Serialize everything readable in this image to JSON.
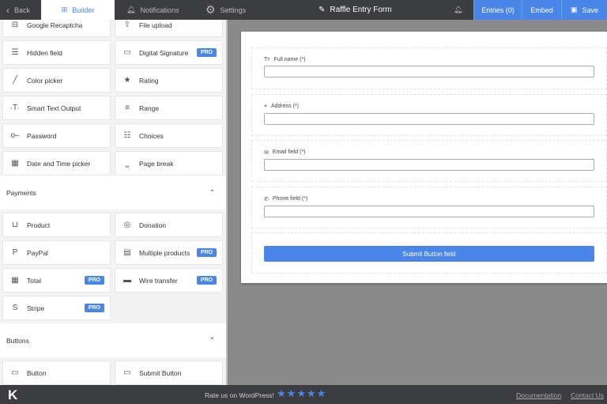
{
  "header": {
    "back": "Back",
    "builder": "Builder",
    "notifications": "Notifications",
    "settings": "Settings",
    "form_title": "Raffle Entry Form",
    "entries": "Entries (0)",
    "embed": "Embed",
    "save": "Save",
    "accent": "#4a86e8"
  },
  "sidebar": {
    "fields": [
      {
        "label": "Google Recaptcha",
        "icon": "recaptcha-icon",
        "glyph": "⊟"
      },
      {
        "label": "File upload",
        "icon": "upload-icon",
        "glyph": "⇧"
      },
      {
        "label": "Hidden field",
        "icon": "hidden-field-icon",
        "glyph": "☰"
      },
      {
        "label": "Digital Signature",
        "icon": "signature-icon",
        "glyph": "▭",
        "pro": "PRO"
      },
      {
        "label": "Color picker",
        "icon": "pencil-icon",
        "glyph": "╱"
      },
      {
        "label": "Rating",
        "icon": "star-icon",
        "glyph": "★"
      },
      {
        "label": "Smart Text Output",
        "icon": "text-icon",
        "glyph": "·T·"
      },
      {
        "label": "Range",
        "icon": "range-icon",
        "glyph": "≡"
      },
      {
        "label": "Password",
        "icon": "key-icon",
        "glyph": "o‒"
      },
      {
        "label": "Choices",
        "icon": "choices-icon",
        "glyph": "☷"
      },
      {
        "label": "Date and Time picker",
        "icon": "calendar-icon",
        "glyph": "▦"
      },
      {
        "label": "Page break",
        "icon": "page-break-icon",
        "glyph": "⎵"
      }
    ],
    "payments_title": "Payments",
    "payments": [
      {
        "label": "Product",
        "icon": "basket-icon",
        "glyph": "⊔"
      },
      {
        "label": "Donation",
        "icon": "coins-icon",
        "glyph": "◎"
      },
      {
        "label": "PayPal",
        "icon": "paypal-icon",
        "glyph": "P"
      },
      {
        "label": "Multiple products",
        "icon": "products-icon",
        "glyph": "▤",
        "pro": "PRO"
      },
      {
        "label": "Total",
        "icon": "calculator-icon",
        "glyph": "▦",
        "pro": "PRO"
      },
      {
        "label": "Wire transfer",
        "icon": "card-icon",
        "glyph": "▬",
        "pro": "PRO"
      },
      {
        "label": "Stripe",
        "icon": "stripe-icon",
        "glyph": "S",
        "pro": "PRO"
      }
    ],
    "buttons_title": "Buttons",
    "buttons": [
      {
        "label": "Button",
        "icon": "button-icon",
        "glyph": "▭"
      },
      {
        "label": "Submit Button",
        "icon": "submit-icon",
        "glyph": "▭"
      }
    ]
  },
  "form": {
    "fields": [
      {
        "label": "Full name (*)",
        "glyph": "Tт"
      },
      {
        "label": "Address (*)",
        "glyph": "⌖"
      },
      {
        "label": "Email field (*)",
        "glyph": "✉"
      },
      {
        "label": "Phone field (*)",
        "glyph": "✆"
      }
    ],
    "submit": "Submit Button field"
  },
  "footer": {
    "logo": "K",
    "rate": "Rate us on WordPress!",
    "stars": 5,
    "documentation": "Documentation",
    "contact": "Contact Us"
  }
}
